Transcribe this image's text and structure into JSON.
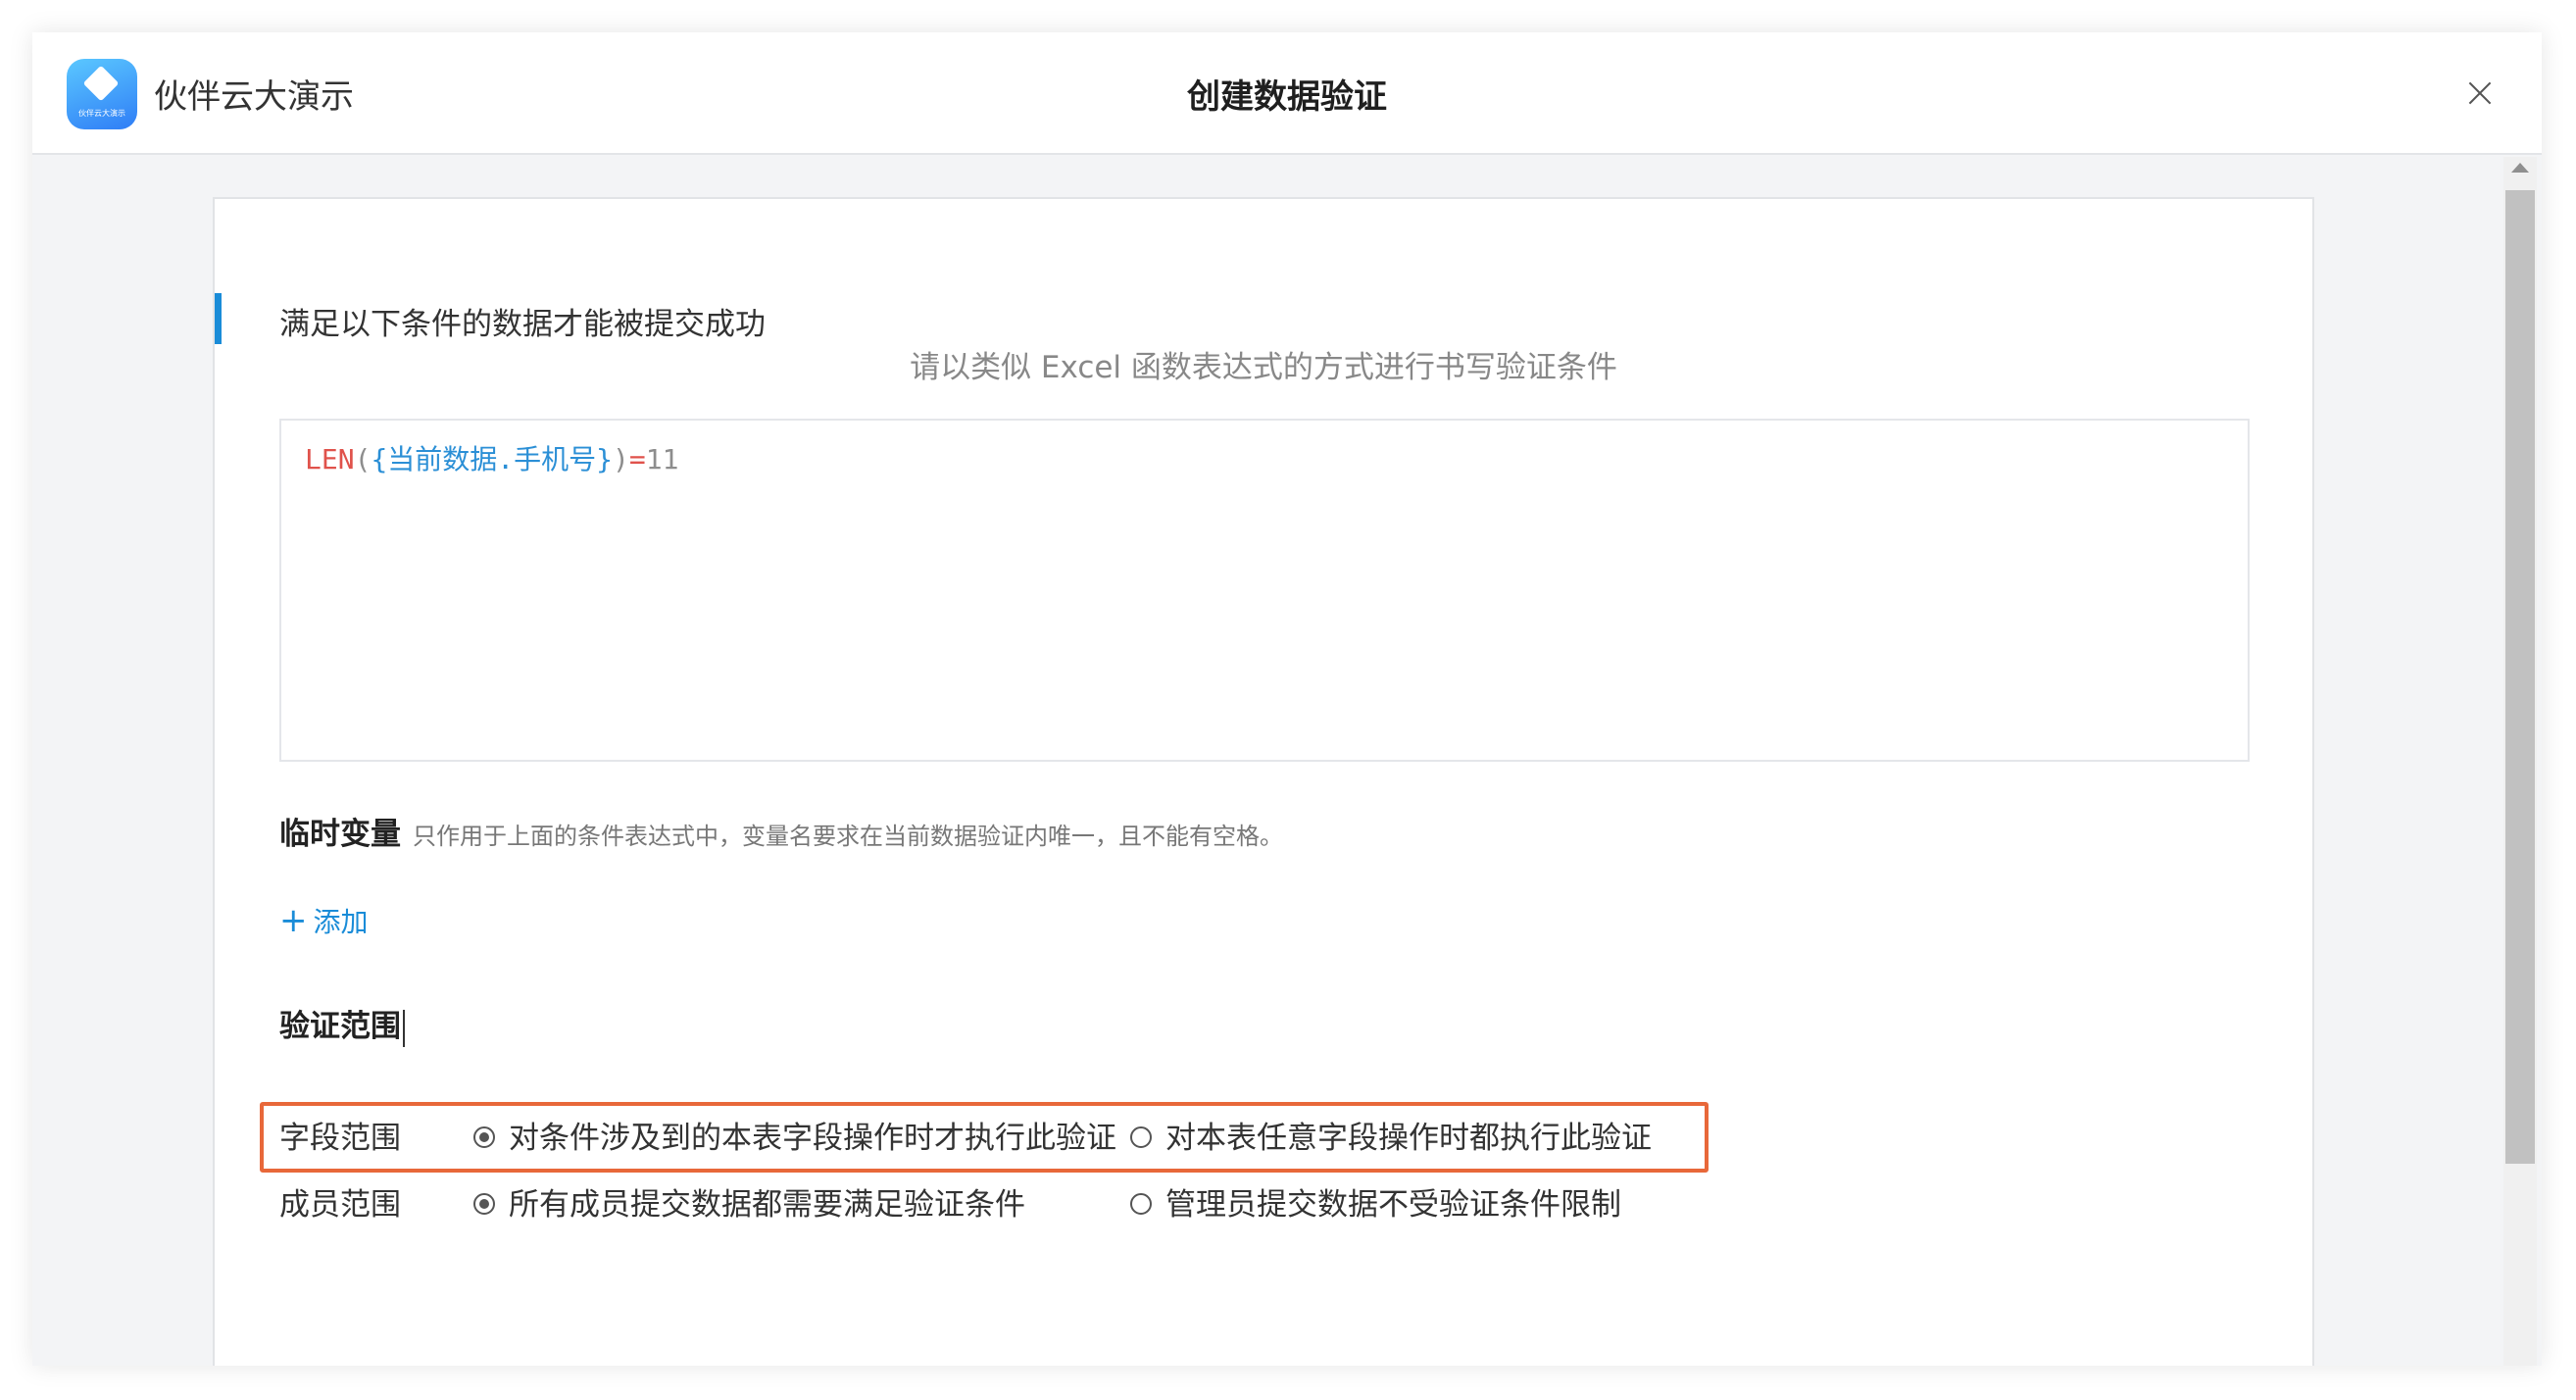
{
  "app": {
    "name": "伙伴云大演示",
    "logo_text": "伙伴云大演示"
  },
  "dialog": {
    "title": "创建数据验证"
  },
  "condition": {
    "title": "满足以下条件的数据才能被提交成功",
    "hint": "请以类似 Excel 函数表达式的方式进行书写验证条件",
    "formula": {
      "fn": "LEN",
      "open": "(",
      "field_open": "{",
      "field": "当前数据.手机号",
      "field_close": "}",
      "close": ")",
      "op": "=",
      "value": "11"
    }
  },
  "temp_vars": {
    "label": "临时变量",
    "description": "只作用于上面的条件表达式中，变量名要求在当前数据验证内唯一，且不能有空格。",
    "add_plus": "+",
    "add_label": "添加"
  },
  "scope": {
    "title": "验证范围",
    "field_scope": {
      "label": "字段范围",
      "options": [
        {
          "label": "对条件涉及到的本表字段操作时才执行此验证",
          "checked": true
        },
        {
          "label": "对本表任意字段操作时都执行此验证",
          "checked": false
        }
      ]
    },
    "member_scope": {
      "label": "成员范围",
      "options": [
        {
          "label": "所有成员提交数据都需要满足验证条件",
          "checked": true
        },
        {
          "label": "管理员提交数据不受验证条件限制",
          "checked": false
        }
      ]
    }
  },
  "colors": {
    "accent": "#1a8cd8",
    "highlight": "#e8683a",
    "formula_function": "#e0524b",
    "formula_field": "#2b8fd6"
  }
}
